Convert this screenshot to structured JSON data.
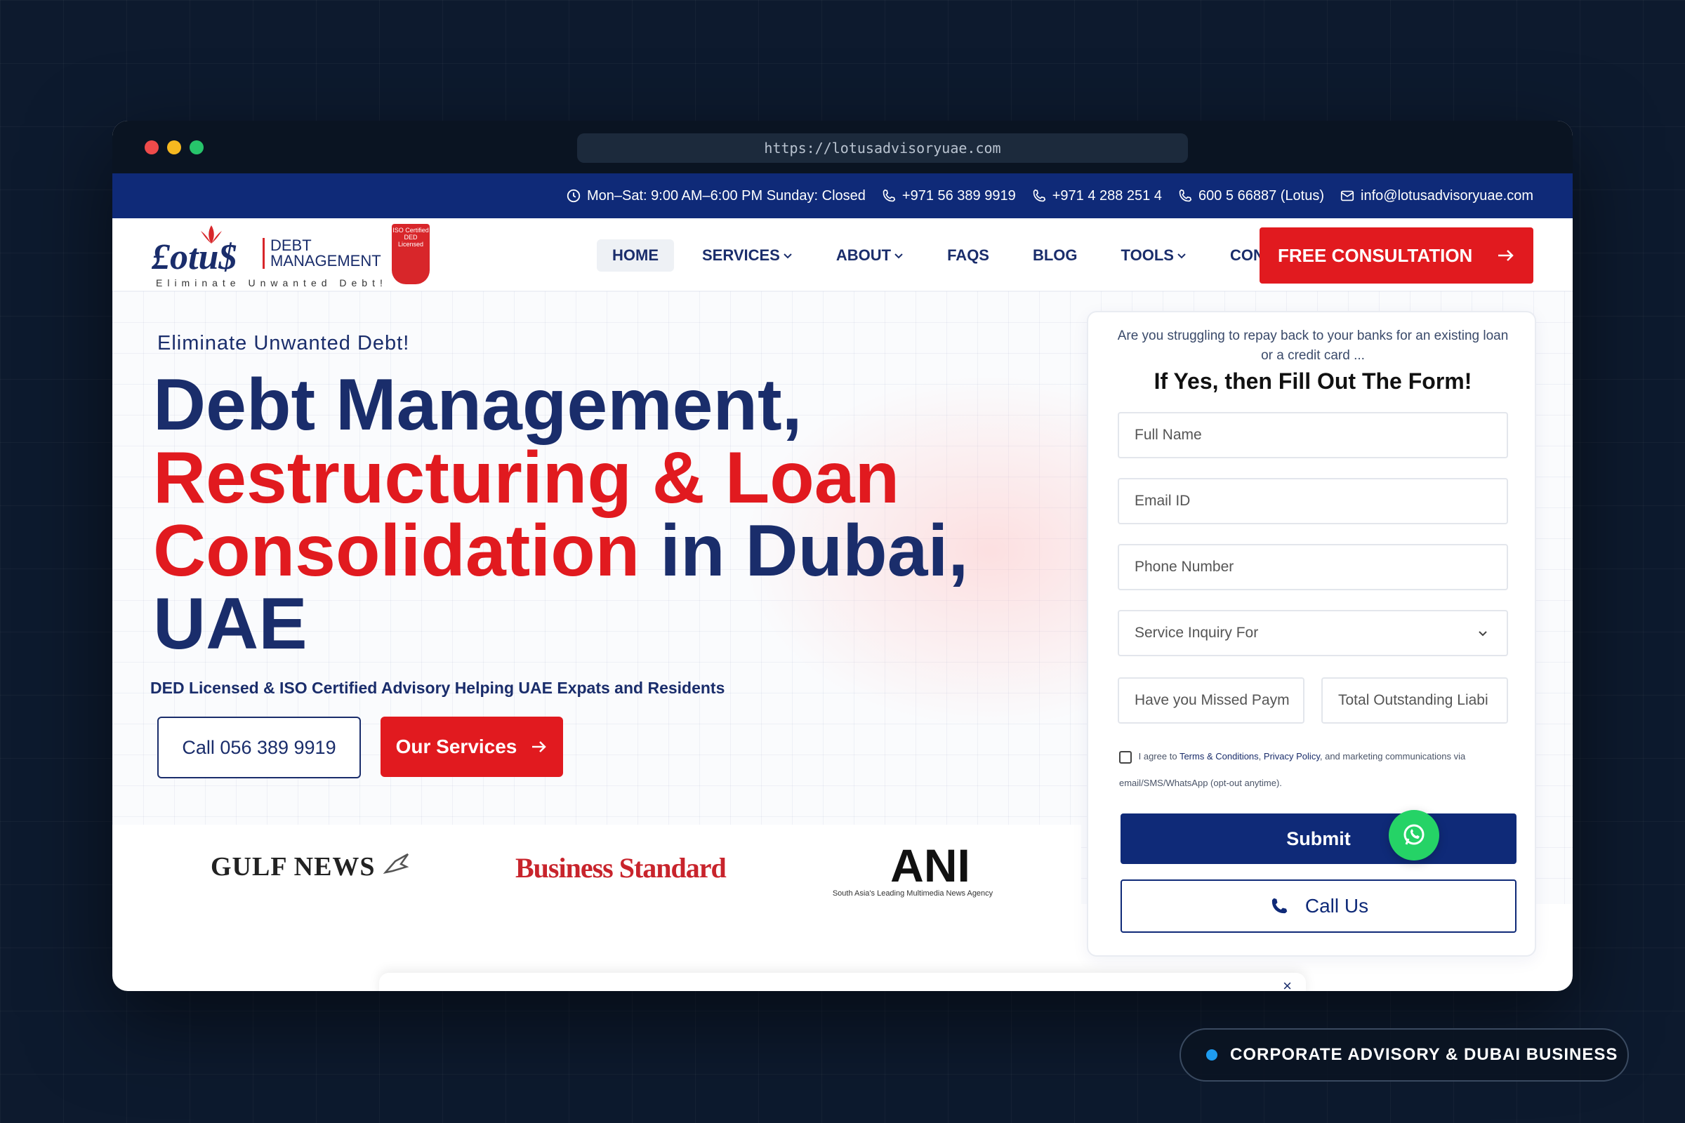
{
  "browser": {
    "url": "https://lotusadvisoryuae.com",
    "dots": [
      "#ee4b4b",
      "#f5b820",
      "#27c46b"
    ]
  },
  "topbar": {
    "hours": "Mon–Sat: 9:00 AM–6:00 PM Sunday: Closed",
    "phone1": "+971 56 389 9919",
    "phone2": "+971 4 288 251 4",
    "phone3": "600 5 66887 (Lotus)",
    "email": "info@lotusadvisoryuae.com"
  },
  "logo": {
    "brand": "£otu$",
    "line1": "DEBT",
    "line2": "MANAGEMENT",
    "tagline": "Eliminate Unwanted Debt!",
    "badge": "ISO Certified DED Licensed"
  },
  "nav": {
    "items": [
      {
        "label": "HOME",
        "icon": ""
      },
      {
        "label": "SERVICES",
        "icon": "chevron-down"
      },
      {
        "label": "ABOUT",
        "icon": "chevron-down"
      },
      {
        "label": "FAQS",
        "icon": ""
      },
      {
        "label": "BLOG",
        "icon": ""
      },
      {
        "label": "TOOLS",
        "icon": "chevron-down"
      },
      {
        "label": "CONTACT",
        "icon": ""
      }
    ],
    "cta": "FREE CONSULTATION"
  },
  "hero": {
    "tagline": "Eliminate Unwanted Debt!",
    "h1_part1": "Debt Management,",
    "h1_part2": "Restructuring & Loan Consolidation",
    "h1_part3": "in Dubai, UAE",
    "subline": "DED Licensed & ISO Certified Advisory Helping UAE Expats and Residents",
    "call_button": "Call 056 389 9919",
    "services_button": "Our Services"
  },
  "press": {
    "gulf": "GULF NEWS",
    "bs": "Business Standard",
    "ani": "ANI",
    "ani_sub": "South Asia's Leading Multimedia News Agency"
  },
  "form": {
    "intro": "Are you struggling to repay back to your banks for an existing loan or a credit card ...",
    "title": "If Yes, then Fill Out The Form!",
    "name_placeholder": "Full Name",
    "email_placeholder": "Email ID",
    "phone_placeholder": "Phone Number",
    "service_select": "Service Inquiry For",
    "missed_placeholder": "Have you Missed Paym",
    "total_placeholder": "Total Outstanding Liabi",
    "agree_prefix": "I agree to",
    "agree_terms": "Terms & Conditions",
    "agree_privacy": "Privacy Policy",
    "agree_suffix": ", and marketing communications via email/SMS/WhatsApp (opt-out anytime).",
    "submit": "Submit",
    "call_us": "Call Us"
  },
  "popup": {
    "close": "×"
  },
  "badge": {
    "label": "CORPORATE ADVISORY & DUBAI BUSINESS"
  },
  "colors": {
    "navy": "#0f2a78",
    "brand_blue": "#1a2d6b",
    "red": "#e11a1f",
    "whatsapp": "#25d366"
  }
}
